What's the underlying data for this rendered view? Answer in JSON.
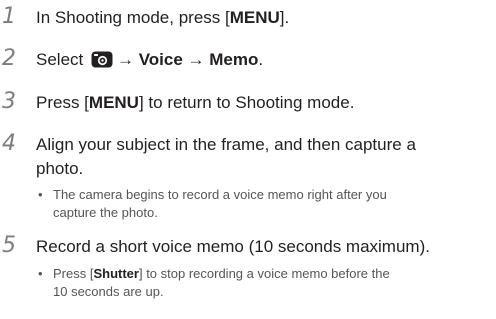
{
  "steps": [
    {
      "num": "1",
      "pre": "In Shooting mode, press [",
      "key": "MENU",
      "post": "]."
    },
    {
      "num": "2",
      "pre": "Select ",
      "icon": "camera-icon",
      "arrow1": "→ ",
      "voice": "Voice",
      "arrow2": " → ",
      "memo": "Memo",
      "post": "."
    },
    {
      "num": "3",
      "pre": "Press [",
      "key": "MENU",
      "post": "] to return to Shooting mode."
    },
    {
      "num": "4",
      "line1": "Align your subject in the frame, and then capture a",
      "line2": "photo.",
      "bullet_dot": "•",
      "bullet_line1": "The camera begins to record a voice memo right after you",
      "bullet_line2": "capture the photo."
    },
    {
      "num": "5",
      "line1": "Record a short voice memo (10 seconds maximum).",
      "bullet_dot": "•",
      "bullet_pre": "Press [",
      "bullet_key": "Shutter",
      "bullet_post": "] to stop recording a voice memo before the",
      "bullet_line2": "10 seconds are up."
    }
  ]
}
